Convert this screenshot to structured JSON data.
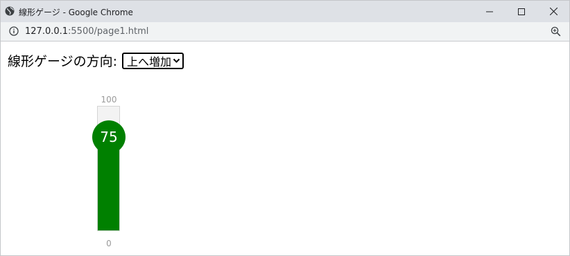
{
  "browser": {
    "window_title": "線形ゲージ - Google Chrome",
    "url_host": "127.0.0.1",
    "url_rest": ":5500/page1.html",
    "icons": {
      "app": "globe-icon",
      "minimize": "minimize-icon",
      "maximize": "maximize-icon",
      "close": "close-icon",
      "info": "info-icon",
      "zoom": "zoom-in-icon"
    }
  },
  "page": {
    "direction_label": "線形ゲージの方向:",
    "direction_select": {
      "selected": "上へ増加"
    }
  },
  "gauge": {
    "min_label": "0",
    "max_label": "100",
    "value": 75,
    "value_label": "75",
    "min": 0,
    "max": 100,
    "fill_color": "#008000",
    "track_color": "#f3f3f3",
    "label_color": "#9a9a9a"
  }
}
